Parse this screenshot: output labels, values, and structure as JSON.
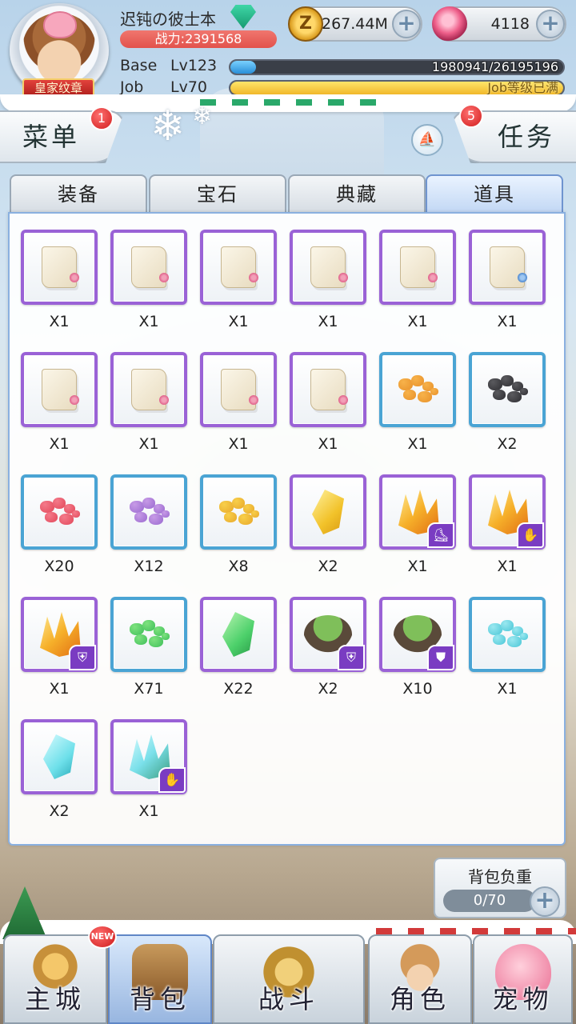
{
  "player": {
    "name": "迟钝の彼士本",
    "badge": "皇家纹章",
    "power": "战力:2391568"
  },
  "currency": {
    "zeny_symbol": "Z",
    "zeny": "267.44M",
    "gems": "4118",
    "plus": "+"
  },
  "levels": {
    "base_label": "Base",
    "base_level": "Lv123",
    "base_exp": "1980941/26195196",
    "base_progress": 0.076,
    "job_label": "Job",
    "job_level": "Lv70",
    "job_exp": "Job等级已满",
    "job_progress": 1.0
  },
  "top_buttons": {
    "menu": "菜单",
    "menu_badge": "1",
    "task": "任务",
    "task_badge": "5"
  },
  "tabs": [
    "装备",
    "宝石",
    "典藏",
    "道具"
  ],
  "active_tab": "道具",
  "items": [
    {
      "icon": "card-scroll-icon",
      "frame": "purple",
      "qty": "X1"
    },
    {
      "icon": "card-scroll-icon",
      "frame": "purple",
      "qty": "X1"
    },
    {
      "icon": "card-scroll-icon",
      "frame": "purple",
      "qty": "X1"
    },
    {
      "icon": "card-scroll-icon",
      "frame": "purple",
      "qty": "X1"
    },
    {
      "icon": "card-scroll-icon",
      "frame": "purple",
      "qty": "X1"
    },
    {
      "icon": "card-scroll-blue-icon",
      "frame": "purple",
      "qty": "X1"
    },
    {
      "icon": "card-scroll-icon",
      "frame": "purple",
      "qty": "X1"
    },
    {
      "icon": "card-scroll-icon",
      "frame": "purple",
      "qty": "X1"
    },
    {
      "icon": "card-scroll-icon",
      "frame": "purple",
      "qty": "X1"
    },
    {
      "icon": "card-scroll-icon",
      "frame": "purple",
      "qty": "X1"
    },
    {
      "icon": "orange-ore-icon",
      "frame": "blue",
      "qty": "X1"
    },
    {
      "icon": "black-ore-icon",
      "frame": "blue",
      "qty": "X2"
    },
    {
      "icon": "red-ore-icon",
      "frame": "blue",
      "qty": "X20"
    },
    {
      "icon": "purple-ore-icon",
      "frame": "blue",
      "qty": "X12"
    },
    {
      "icon": "yellow-ore-icon",
      "frame": "blue",
      "qty": "X8"
    },
    {
      "icon": "yellow-crystal-icon",
      "frame": "purple",
      "qty": "X2"
    },
    {
      "icon": "orange-crystal-cluster-icon",
      "frame": "purple",
      "qty": "X1",
      "badge": "boots-icon"
    },
    {
      "icon": "orange-crystal-cluster-icon",
      "frame": "purple",
      "qty": "X1",
      "badge": "gloves-icon"
    },
    {
      "icon": "orange-crystal-cluster-icon",
      "frame": "purple",
      "qty": "X1",
      "badge": "shield-icon"
    },
    {
      "icon": "green-ore-icon",
      "frame": "blue",
      "qty": "X71"
    },
    {
      "icon": "green-crystal-icon",
      "frame": "purple",
      "qty": "X22"
    },
    {
      "icon": "floating-island-icon",
      "frame": "purple",
      "qty": "X2",
      "badge": "shield-icon"
    },
    {
      "icon": "floating-island-icon",
      "frame": "purple",
      "qty": "X10",
      "badge": "armor-icon"
    },
    {
      "icon": "cyan-ore-icon",
      "frame": "blue",
      "qty": "X1"
    },
    {
      "icon": "cyan-crystal-icon",
      "frame": "purple",
      "qty": "X2"
    },
    {
      "icon": "cyan-crystal-cluster-icon",
      "frame": "purple",
      "qty": "X1",
      "badge": "gloves-icon"
    }
  ],
  "bag_weight": {
    "label": "背包负重",
    "value": "0/70",
    "plus": "+"
  },
  "bottom_nav": {
    "new_badge": "NEW",
    "items": [
      "主城",
      "背包",
      "战斗",
      "角色",
      "宠物"
    ],
    "active": "背包"
  },
  "colors": {
    "purple_frame": "#9a62d6",
    "blue_frame": "#4aa4d4",
    "power_bar": "#e2524c",
    "active_tab": "#c0d6f4"
  }
}
